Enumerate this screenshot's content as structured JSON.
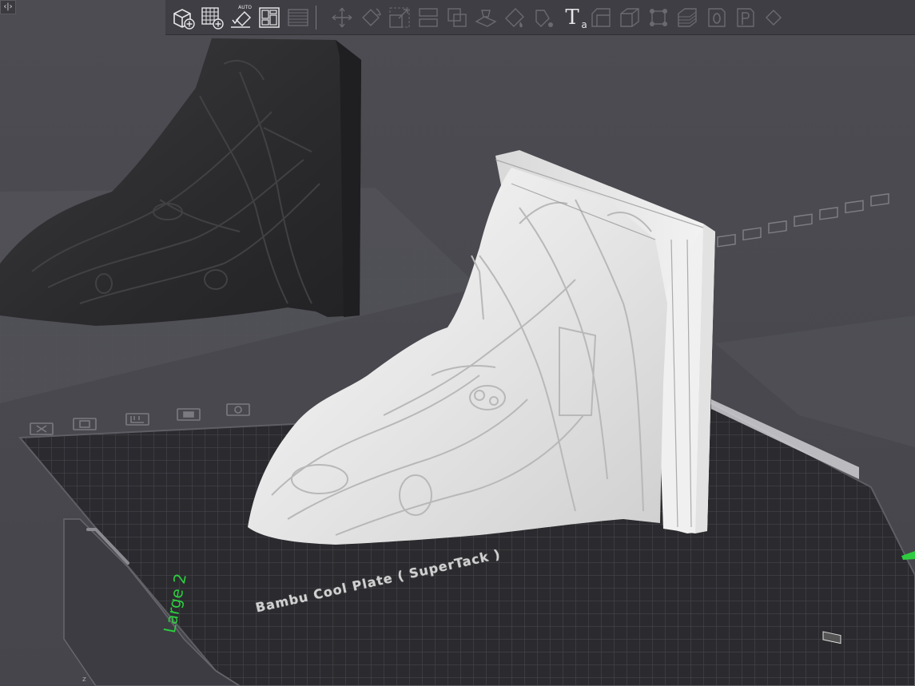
{
  "app": {
    "collapse_button_label": "‹|›"
  },
  "toolbar": {
    "buttons": [
      {
        "name": "add-object-button",
        "icon": "cube-plus-icon"
      },
      {
        "name": "add-plate-button",
        "icon": "grid-plus-icon"
      },
      {
        "name": "auto-orient-button",
        "icon": "auto-orient-icon",
        "badge": "AUTO"
      },
      {
        "name": "arrange-button",
        "icon": "layout-icon"
      },
      {
        "name": "split-plates-button",
        "icon": "plates-icon"
      },
      {
        "name": "move-button",
        "icon": "move-icon"
      },
      {
        "name": "rotate-button",
        "icon": "rotate-icon"
      },
      {
        "name": "scale-button",
        "icon": "scale-icon"
      },
      {
        "name": "place-on-face-button",
        "icon": "lay-on-face-icon"
      },
      {
        "name": "cut-button",
        "icon": "cut-icon"
      },
      {
        "name": "boolean-button",
        "icon": "boolean-icon"
      },
      {
        "name": "support-paint-button",
        "icon": "support-paint-icon"
      },
      {
        "name": "color-paint-button",
        "icon": "color-paint-icon"
      },
      {
        "name": "text-button",
        "icon": "text-icon",
        "label": "T",
        "sublabel": "a"
      },
      {
        "name": "seam-button",
        "icon": "seam-icon"
      },
      {
        "name": "assembly-button",
        "icon": "box-icon"
      },
      {
        "name": "measure-button",
        "icon": "measure-icon"
      },
      {
        "name": "layers-button",
        "icon": "layers-icon"
      },
      {
        "name": "zero-button",
        "icon": "zero-icon"
      },
      {
        "name": "p-button",
        "icon": "p-icon"
      },
      {
        "name": "more-button",
        "icon": "more-icon"
      }
    ]
  },
  "scene": {
    "plate_label": "Bambu Cool Plate ( SuperTack )",
    "plate_size_label": "Large 2",
    "axis_label": "z",
    "plate_icons": [
      "close-icon",
      "auto-orient-icon",
      "arrange-icon",
      "lock-icon",
      "settings-icon"
    ],
    "colors": {
      "background": "#4a4a50",
      "plate": "#2b2b2f",
      "grid": "#4a4a50",
      "model": "#eeeeee",
      "shadow_model": "#2a2a2c",
      "label_green": "#2ecc40"
    }
  }
}
